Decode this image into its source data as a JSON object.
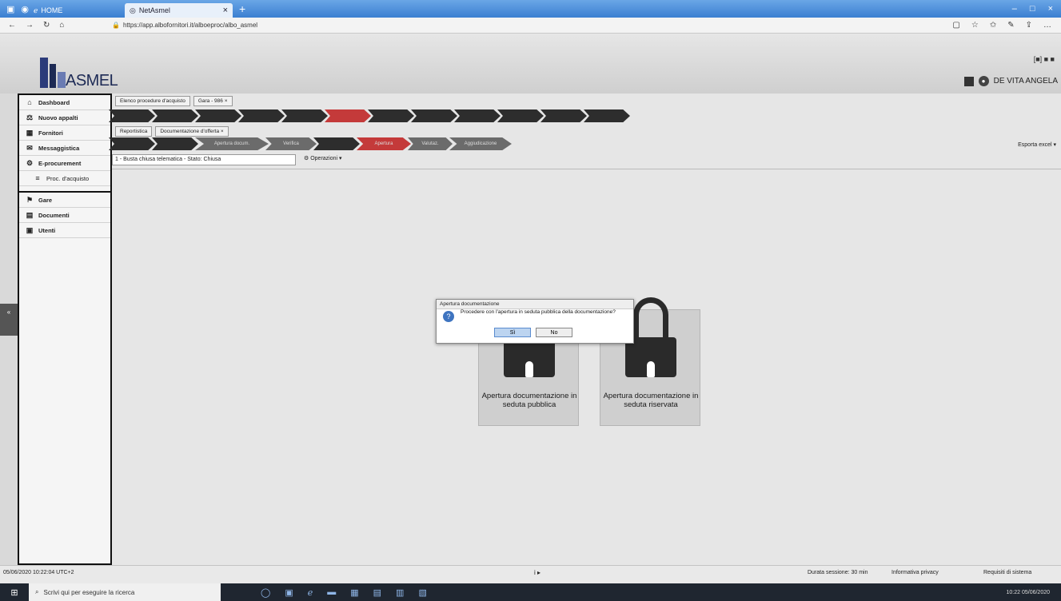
{
  "browser": {
    "tabs": [
      {
        "label": "HOME"
      },
      {
        "label": "NetAsmel",
        "close": "×"
      }
    ],
    "new_tab": "+",
    "url": "https://app.albofornitori.it/alboeproc/albo_asmel",
    "window_controls": [
      "–",
      "□",
      "×"
    ]
  },
  "header": {
    "logo_text": "ASMEL",
    "icons_text": "[■] ■ ■",
    "user_name": "DE VITA ANGELA"
  },
  "sidebar": {
    "items": [
      {
        "label": "Dashboard",
        "icon": "home-icon",
        "glyph": "⌂"
      },
      {
        "label": "Nuovo appalti",
        "icon": "scale-icon",
        "glyph": "⚖"
      },
      {
        "label": "Fornitori",
        "icon": "building-icon",
        "glyph": "▦"
      },
      {
        "label": "Messaggistica",
        "icon": "message-icon",
        "glyph": "✉"
      },
      {
        "label": "E-procurement",
        "icon": "procurement-icon",
        "glyph": "⚙"
      },
      {
        "label": "Proc. d'acquisto",
        "icon": "list-icon",
        "glyph": "≡",
        "sub": true
      },
      {
        "label": "Gare",
        "icon": "gavel-icon",
        "glyph": "⚑"
      },
      {
        "label": "Documenti",
        "icon": "document-icon",
        "glyph": "▤"
      },
      {
        "label": "Utenti",
        "icon": "user-icon",
        "glyph": "▣"
      }
    ],
    "handle": "«"
  },
  "main": {
    "tabs_row1": [
      "Elenco procedure d'acquisto",
      "Gara - 986 ×"
    ],
    "tabs_row2": [
      "Reportistica",
      "Documentazione d'offerta ×"
    ],
    "step_labels_row2": [
      "",
      "",
      "Apertura docum.",
      "Verifica",
      "",
      "Apertura",
      "Valutaz.",
      "Aggiudicazione"
    ],
    "select_value": "1 - Busta chiusa telematica - Stato: Chiusa",
    "operations": "⚙ Operazioni ▾",
    "export": "Esporta excel ▾",
    "cards": [
      {
        "label": "Apertura documentazione in seduta pubblica"
      },
      {
        "label": "Apertura documentazione in seduta riservata"
      }
    ]
  },
  "dialog": {
    "title": "Apertura documentazione",
    "message": "Procedere con l'apertura in seduta pubblica della documentazione?",
    "yes": "Sì",
    "no": "No"
  },
  "statusbar": {
    "datetime": "05/06/2020 10:22:04 UTC+2",
    "center": "i ▸",
    "session": "Durata sessione: 30 min",
    "privacy": "Informativa privacy",
    "requirements": "Requisiti di sistema"
  },
  "taskbar": {
    "search_placeholder": "Scrivi qui per eseguire la ricerca",
    "clock": "10:22 05/06/2020"
  }
}
